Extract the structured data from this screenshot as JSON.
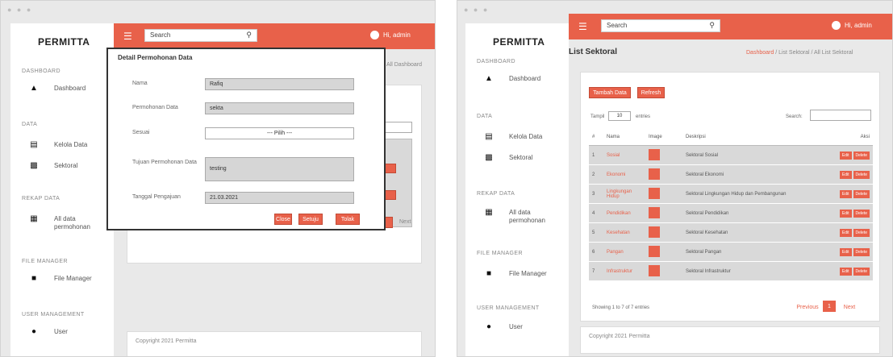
{
  "colors": {
    "accent": "#e8614a",
    "sidebar": "#ffffff",
    "frame": "#e9e9e9"
  },
  "window_dots": "● ● ●",
  "left": {
    "brand": "PERMITTA",
    "search_placeholder": "Search",
    "user_name": "Hi, admin",
    "breadcrumb_tail": "All Dashboard",
    "sidebar": {
      "sections": [
        "DASHBOARD",
        "DATA",
        "REKAP DATA",
        "FILE MANAGER",
        "USER MANAGEMENT"
      ],
      "items": [
        {
          "icon": "home-icon",
          "label": "Dashboard"
        },
        {
          "icon": "list-icon",
          "label": "Kelola Data"
        },
        {
          "icon": "book-icon",
          "label": "Sektoral"
        },
        {
          "icon": "table-icon",
          "label": "All data permohonan"
        },
        {
          "icon": "folder-icon",
          "label": "File Manager"
        },
        {
          "icon": "user-icon",
          "label": "User"
        }
      ]
    },
    "modal": {
      "title": "Detail Permohonan Data",
      "fields": [
        {
          "label": "Nama",
          "value": "Rafiq"
        },
        {
          "label": "Permohonan Data",
          "value": "sekta"
        },
        {
          "label": "Sesuai",
          "value": "--- Pilih ---"
        },
        {
          "label": "Tujuan Permohonan Data",
          "value": "testing"
        },
        {
          "label": "Tanggal Pengajuan",
          "value": "21.03.2021"
        }
      ],
      "buttons": [
        "Close",
        "Setuju",
        "Tolak"
      ]
    },
    "next_label": "Next",
    "footer": "Copyright 2021 Permitta"
  },
  "right": {
    "brand": "PERMITTA",
    "search_placeholder": "Search",
    "user_name": "Hi, admin",
    "page_title": "List Sektoral",
    "breadcrumb": {
      "link": "Dashboard",
      "rest": "/ List Sektoral / All List Sektoral"
    },
    "sidebar": {
      "sections": [
        "DASHBOARD",
        "DATA",
        "REKAP DATA",
        "FILE MANAGER",
        "USER MANAGEMENT"
      ],
      "items": [
        {
          "icon": "home-icon",
          "label": "Dashboard"
        },
        {
          "icon": "list-icon",
          "label": "Kelola Data"
        },
        {
          "icon": "book-icon",
          "label": "Sektoral"
        },
        {
          "icon": "table-icon",
          "label": "All data permohonan"
        },
        {
          "icon": "folder-icon",
          "label": "File Manager"
        },
        {
          "icon": "user-icon",
          "label": "User"
        }
      ]
    },
    "buttons": {
      "add": "Tambah Data",
      "refresh": "Refresh"
    },
    "show_label": "Tampil",
    "show_value": "10",
    "entries_label": "entries",
    "search_label": "Search:",
    "table": {
      "headers": [
        "#",
        "Nama",
        "Image",
        "Deskripsi",
        "Aksi"
      ],
      "rows": [
        {
          "no": "1",
          "name": "Sosial",
          "desc": "Sektoral Sosial"
        },
        {
          "no": "2",
          "name": "Ekonomi",
          "desc": "Sektoral Ekonomi"
        },
        {
          "no": "3",
          "name": "Lingkungan Hidup",
          "desc": "Sektoral Lingkungan Hidup dan Pembangunan"
        },
        {
          "no": "4",
          "name": "Pendidikan",
          "desc": "Sektoral Pendidikan"
        },
        {
          "no": "5",
          "name": "Kesehatan",
          "desc": "Sektoral Kesehatan"
        },
        {
          "no": "6",
          "name": "Pangan",
          "desc": "Sektoral Pangan"
        },
        {
          "no": "7",
          "name": "Infrastruktur",
          "desc": "Sektoral Infrastruktur"
        }
      ],
      "action_edit": "Edit",
      "action_delete": "Delete"
    },
    "showing": "Showing 1 to 7 of 7 entries",
    "pagination": {
      "prev": "Previous",
      "page": "1",
      "next": "Next"
    },
    "footer": "Copyright 2021 Permitta"
  }
}
